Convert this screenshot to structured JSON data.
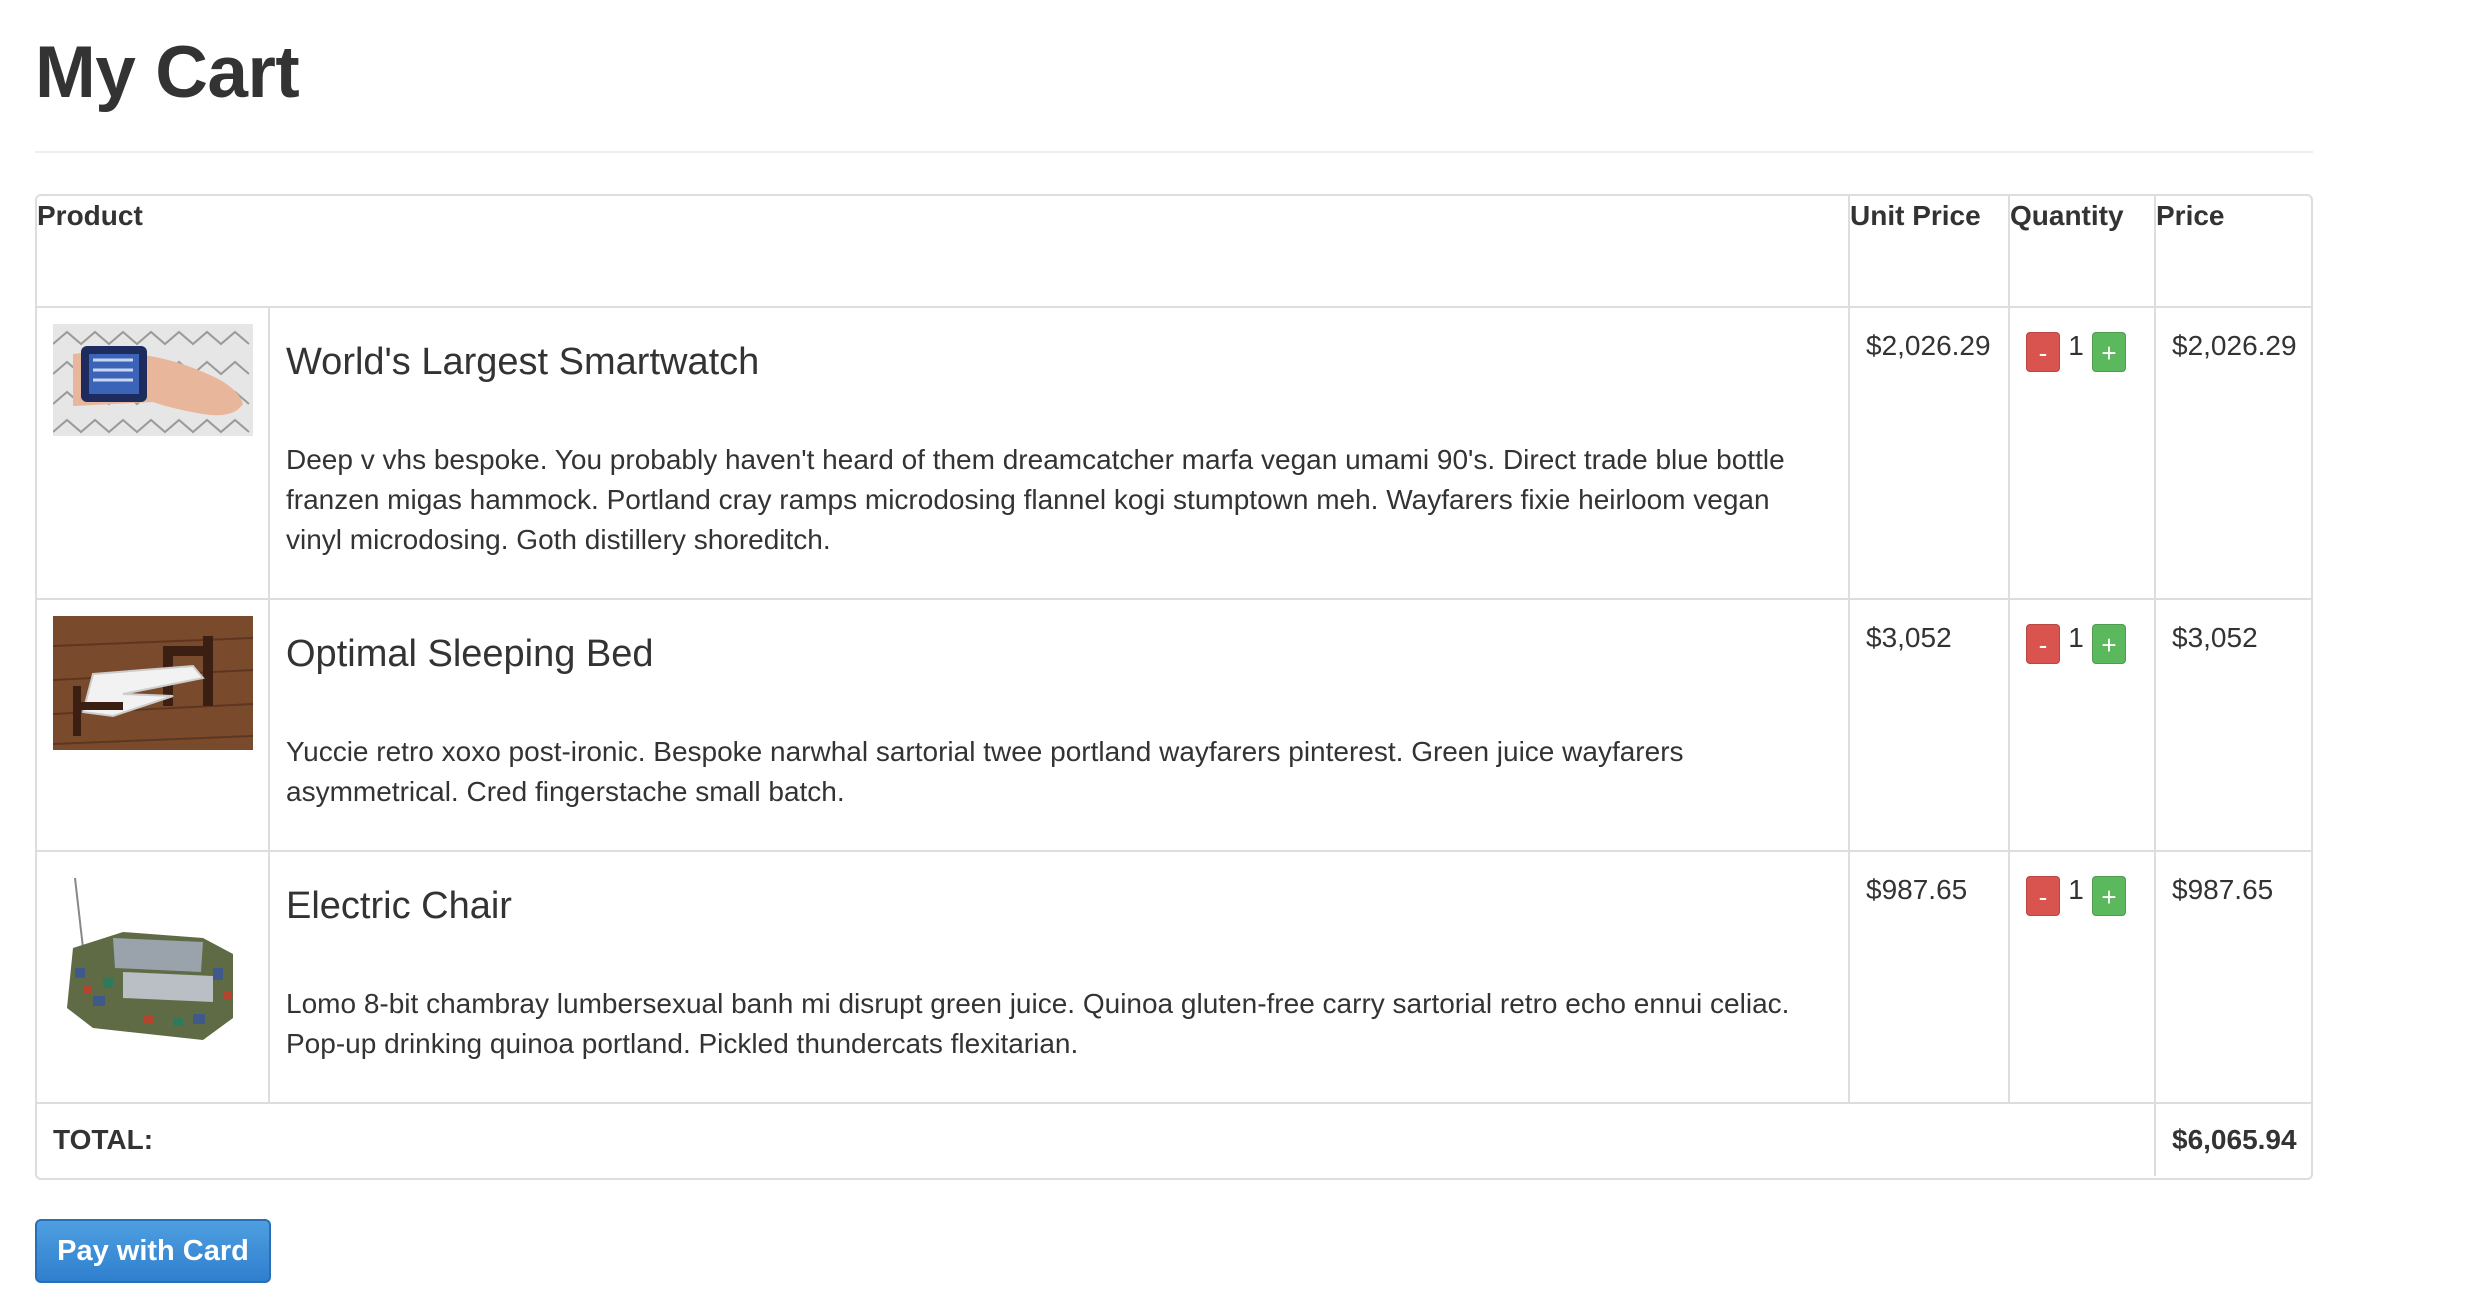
{
  "page": {
    "title": "My Cart"
  },
  "table": {
    "headers": {
      "product": "Product",
      "unit_price": "Unit Price",
      "quantity": "Quantity",
      "price": "Price"
    },
    "items": [
      {
        "name": "World's Largest Smartwatch",
        "description": "Deep v vhs bespoke. You probably haven't heard of them dreamcatcher marfa vegan umami 90's. Direct trade blue bottle franzen migas hammock. Portland cray ramps microdosing flannel kogi stumptown meh. Wayfarers fixie heirloom vegan vinyl microdosing. Goth distillery shoreditch.",
        "unit_price": "$2,026.29",
        "quantity": "1",
        "price": "$2,026.29",
        "thumbnail": "smartwatch-photo"
      },
      {
        "name": "Optimal Sleeping Bed",
        "description": "Yuccie retro xoxo post-ironic. Bespoke narwhal sartorial twee portland wayfarers pinterest. Green juice wayfarers asymmetrical. Cred fingerstache small batch.",
        "unit_price": "$3,052",
        "quantity": "1",
        "price": "$3,052",
        "thumbnail": "bed-photo"
      },
      {
        "name": "Electric Chair",
        "description": "Lomo 8-bit chambray lumbersexual banh mi disrupt green juice. Quinoa gluten-free carry sartorial retro echo ennui celiac. Pop-up drinking quinoa portland. Pickled thundercats flexitarian.",
        "unit_price": "$987.65",
        "quantity": "1",
        "price": "$987.65",
        "thumbnail": "chair-photo"
      }
    ],
    "qty_minus_label": "-",
    "qty_plus_label": "+",
    "total_label": "TOTAL:",
    "total_value": "$6,065.94"
  },
  "actions": {
    "pay_label": "Pay with Card"
  },
  "colors": {
    "minus_button": "#d9534f",
    "plus_button": "#5cb85c",
    "pay_button": "#3a8bd6",
    "border": "#dddddd"
  }
}
